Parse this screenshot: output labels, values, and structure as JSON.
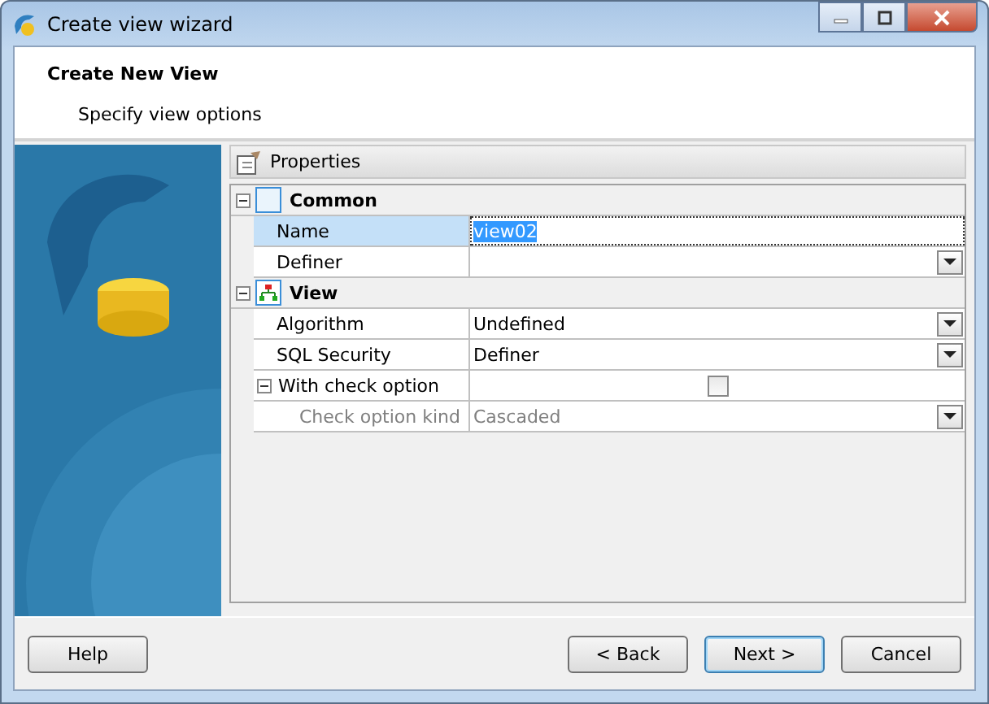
{
  "window": {
    "title": "Create view wizard"
  },
  "header": {
    "title": "Create New View",
    "subtitle": "Specify view options"
  },
  "properties": {
    "title": "Properties",
    "groups": [
      {
        "label": "Common",
        "kind": "common",
        "expanded": true,
        "rows": [
          {
            "label": "Name",
            "value": "view02",
            "kind": "text",
            "selected": true,
            "disabled": false
          },
          {
            "label": "Definer",
            "kind": "dropdown",
            "selected": false,
            "disabled": false
          }
        ]
      },
      {
        "label": "View",
        "kind": "view",
        "expanded": true,
        "rows": [
          {
            "label": "Algorithm",
            "value": "Undefined",
            "kind": "dropdown",
            "selected": false,
            "disabled": false
          },
          {
            "label": "SQL Security",
            "value": "Definer",
            "kind": "dropdown",
            "selected": false,
            "disabled": false
          },
          {
            "label": "With check option",
            "kind": "checkbox",
            "checked": false,
            "selected": false,
            "disabled": false,
            "expanded": true,
            "children": [
              {
                "label": "Check option kind",
                "value": "Cascaded",
                "kind": "dropdown",
                "selected": false,
                "disabled": true
              }
            ]
          }
        ]
      }
    ]
  },
  "buttons": [
    {
      "label": "Help",
      "default": false
    },
    {
      "label": "< Back",
      "default": false
    },
    {
      "label": "Next >",
      "default": true
    },
    {
      "label": "Cancel",
      "default": false
    }
  ]
}
